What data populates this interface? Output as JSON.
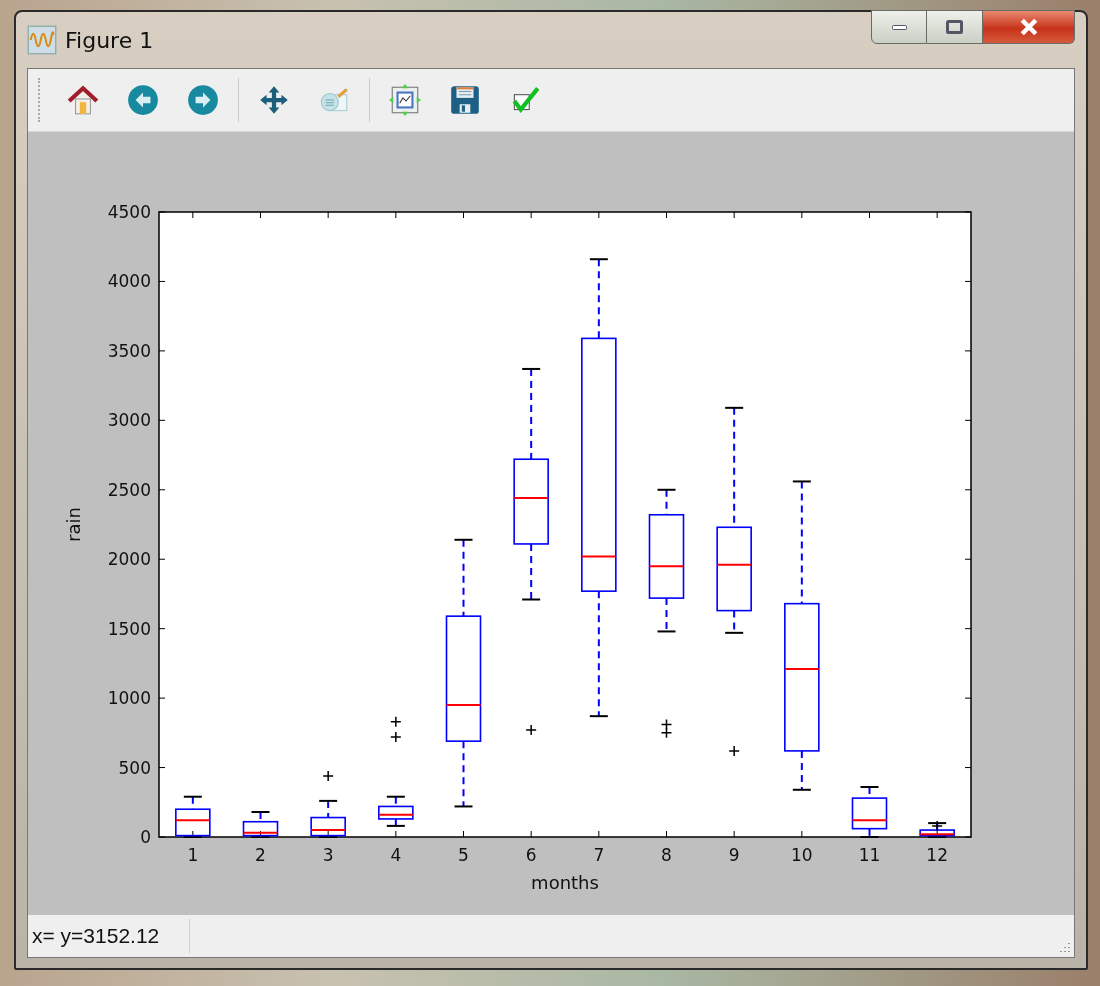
{
  "window": {
    "title": "Figure 1"
  },
  "toolbar": {
    "buttons": [
      {
        "kind": "home"
      },
      {
        "kind": "back"
      },
      {
        "kind": "forward"
      },
      {
        "kind": "separator"
      },
      {
        "kind": "pan"
      },
      {
        "kind": "zoom"
      },
      {
        "kind": "separator"
      },
      {
        "kind": "subplots"
      },
      {
        "kind": "save"
      },
      {
        "kind": "edit"
      }
    ]
  },
  "figure": {
    "xlabel": "months",
    "ylabel": "rain",
    "xticks": [
      "1",
      "2",
      "3",
      "4",
      "5",
      "6",
      "7",
      "8",
      "9",
      "10",
      "11",
      "12"
    ],
    "yticks": [
      "4500",
      "4000",
      "3500",
      "3000",
      "2500",
      "2000",
      "1500",
      "1000",
      "500",
      "0"
    ]
  },
  "status_bar": {
    "text": "x= y=3152.12"
  }
}
